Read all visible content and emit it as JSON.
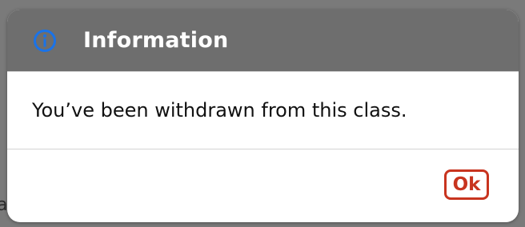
{
  "backdrop": {
    "partial_text": "a"
  },
  "dialog": {
    "icon": "info-icon",
    "title": "Information",
    "message": "You’ve been withdrawn from this class.",
    "ok_label": "Ok"
  },
  "colors": {
    "header_background": "#6e6e6e",
    "icon_blue": "#1a73e8",
    "button_red": "#c8341f",
    "backdrop": "#7a7a7a"
  }
}
